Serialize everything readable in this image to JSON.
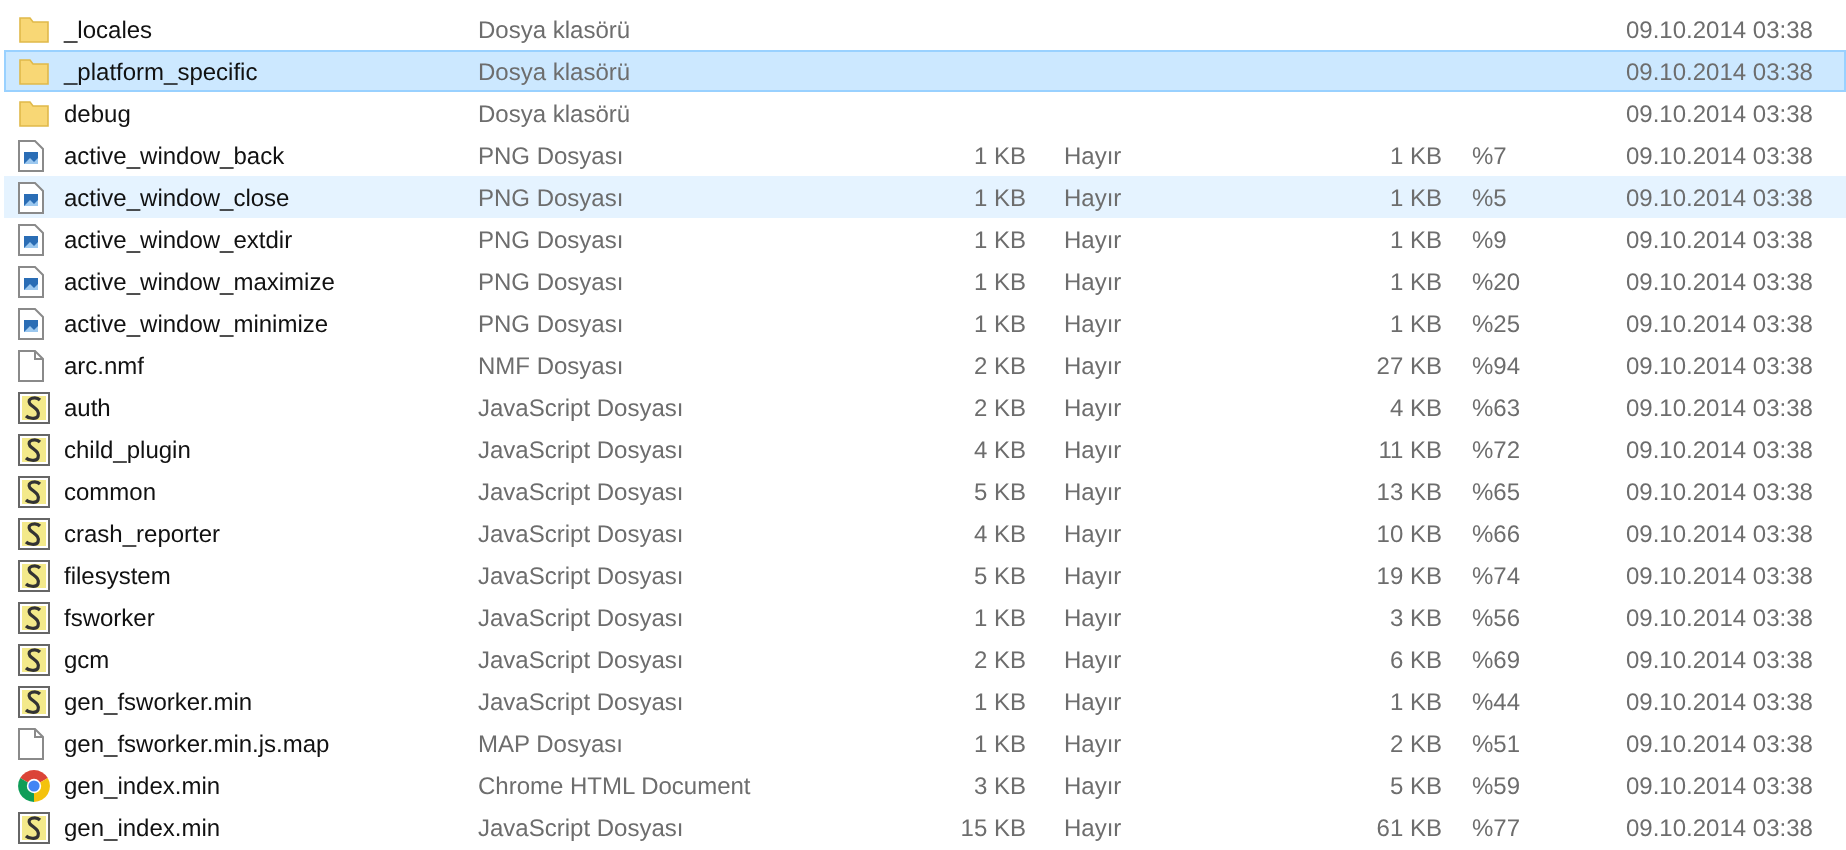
{
  "rows": [
    {
      "kind": "folder",
      "name": "_locales",
      "type": "Dosya klasörü",
      "date": "09.10.2014 03:38",
      "selected": false,
      "hovered": false
    },
    {
      "kind": "folder",
      "name": "_platform_specific",
      "type": "Dosya klasörü",
      "date": "09.10.2014 03:38",
      "selected": true,
      "hovered": false
    },
    {
      "kind": "folder",
      "name": "debug",
      "type": "Dosya klasörü",
      "date": "09.10.2014 03:38",
      "selected": false,
      "hovered": false
    },
    {
      "kind": "image",
      "name": "active_window_back",
      "type": "PNG Dosyası",
      "size": "1 KB",
      "encrypted": "Hayır",
      "packed": "1 KB",
      "ratio": "%7",
      "date": "09.10.2014 03:38",
      "selected": false,
      "hovered": false
    },
    {
      "kind": "image",
      "name": "active_window_close",
      "type": "PNG Dosyası",
      "size": "1 KB",
      "encrypted": "Hayır",
      "packed": "1 KB",
      "ratio": "%5",
      "date": "09.10.2014 03:38",
      "selected": false,
      "hovered": true
    },
    {
      "kind": "image",
      "name": "active_window_extdir",
      "type": "PNG Dosyası",
      "size": "1 KB",
      "encrypted": "Hayır",
      "packed": "1 KB",
      "ratio": "%9",
      "date": "09.10.2014 03:38",
      "selected": false,
      "hovered": false
    },
    {
      "kind": "image",
      "name": "active_window_maximize",
      "type": "PNG Dosyası",
      "size": "1 KB",
      "encrypted": "Hayır",
      "packed": "1 KB",
      "ratio": "%20",
      "date": "09.10.2014 03:38",
      "selected": false,
      "hovered": false
    },
    {
      "kind": "image",
      "name": "active_window_minimize",
      "type": "PNG Dosyası",
      "size": "1 KB",
      "encrypted": "Hayır",
      "packed": "1 KB",
      "ratio": "%25",
      "date": "09.10.2014 03:38",
      "selected": false,
      "hovered": false
    },
    {
      "kind": "file",
      "name": "arc.nmf",
      "type": "NMF Dosyası",
      "size": "2 KB",
      "encrypted": "Hayır",
      "packed": "27 KB",
      "ratio": "%94",
      "date": "09.10.2014 03:38",
      "selected": false,
      "hovered": false
    },
    {
      "kind": "script",
      "name": "auth",
      "type": "JavaScript Dosyası",
      "size": "2 KB",
      "encrypted": "Hayır",
      "packed": "4 KB",
      "ratio": "%63",
      "date": "09.10.2014 03:38",
      "selected": false,
      "hovered": false
    },
    {
      "kind": "script",
      "name": "child_plugin",
      "type": "JavaScript Dosyası",
      "size": "4 KB",
      "encrypted": "Hayır",
      "packed": "11 KB",
      "ratio": "%72",
      "date": "09.10.2014 03:38",
      "selected": false,
      "hovered": false
    },
    {
      "kind": "script",
      "name": "common",
      "type": "JavaScript Dosyası",
      "size": "5 KB",
      "encrypted": "Hayır",
      "packed": "13 KB",
      "ratio": "%65",
      "date": "09.10.2014 03:38",
      "selected": false,
      "hovered": false
    },
    {
      "kind": "script",
      "name": "crash_reporter",
      "type": "JavaScript Dosyası",
      "size": "4 KB",
      "encrypted": "Hayır",
      "packed": "10 KB",
      "ratio": "%66",
      "date": "09.10.2014 03:38",
      "selected": false,
      "hovered": false
    },
    {
      "kind": "script",
      "name": "filesystem",
      "type": "JavaScript Dosyası",
      "size": "5 KB",
      "encrypted": "Hayır",
      "packed": "19 KB",
      "ratio": "%74",
      "date": "09.10.2014 03:38",
      "selected": false,
      "hovered": false
    },
    {
      "kind": "script",
      "name": "fsworker",
      "type": "JavaScript Dosyası",
      "size": "1 KB",
      "encrypted": "Hayır",
      "packed": "3 KB",
      "ratio": "%56",
      "date": "09.10.2014 03:38",
      "selected": false,
      "hovered": false
    },
    {
      "kind": "script",
      "name": "gcm",
      "type": "JavaScript Dosyası",
      "size": "2 KB",
      "encrypted": "Hayır",
      "packed": "6 KB",
      "ratio": "%69",
      "date": "09.10.2014 03:38",
      "selected": false,
      "hovered": false
    },
    {
      "kind": "script",
      "name": "gen_fsworker.min",
      "type": "JavaScript Dosyası",
      "size": "1 KB",
      "encrypted": "Hayır",
      "packed": "1 KB",
      "ratio": "%44",
      "date": "09.10.2014 03:38",
      "selected": false,
      "hovered": false
    },
    {
      "kind": "file",
      "name": "gen_fsworker.min.js.map",
      "type": "MAP Dosyası",
      "size": "1 KB",
      "encrypted": "Hayır",
      "packed": "2 KB",
      "ratio": "%51",
      "date": "09.10.2014 03:38",
      "selected": false,
      "hovered": false
    },
    {
      "kind": "browser",
      "name": "gen_index.min",
      "type": "Chrome HTML Document",
      "size": "3 KB",
      "encrypted": "Hayır",
      "packed": "5 KB",
      "ratio": "%59",
      "date": "09.10.2014 03:38",
      "selected": false,
      "hovered": false
    },
    {
      "kind": "script",
      "name": "gen_index.min",
      "type": "JavaScript Dosyası",
      "size": "15 KB",
      "encrypted": "Hayır",
      "packed": "61 KB",
      "ratio": "%77",
      "date": "09.10.2014 03:38",
      "selected": false,
      "hovered": false
    }
  ]
}
